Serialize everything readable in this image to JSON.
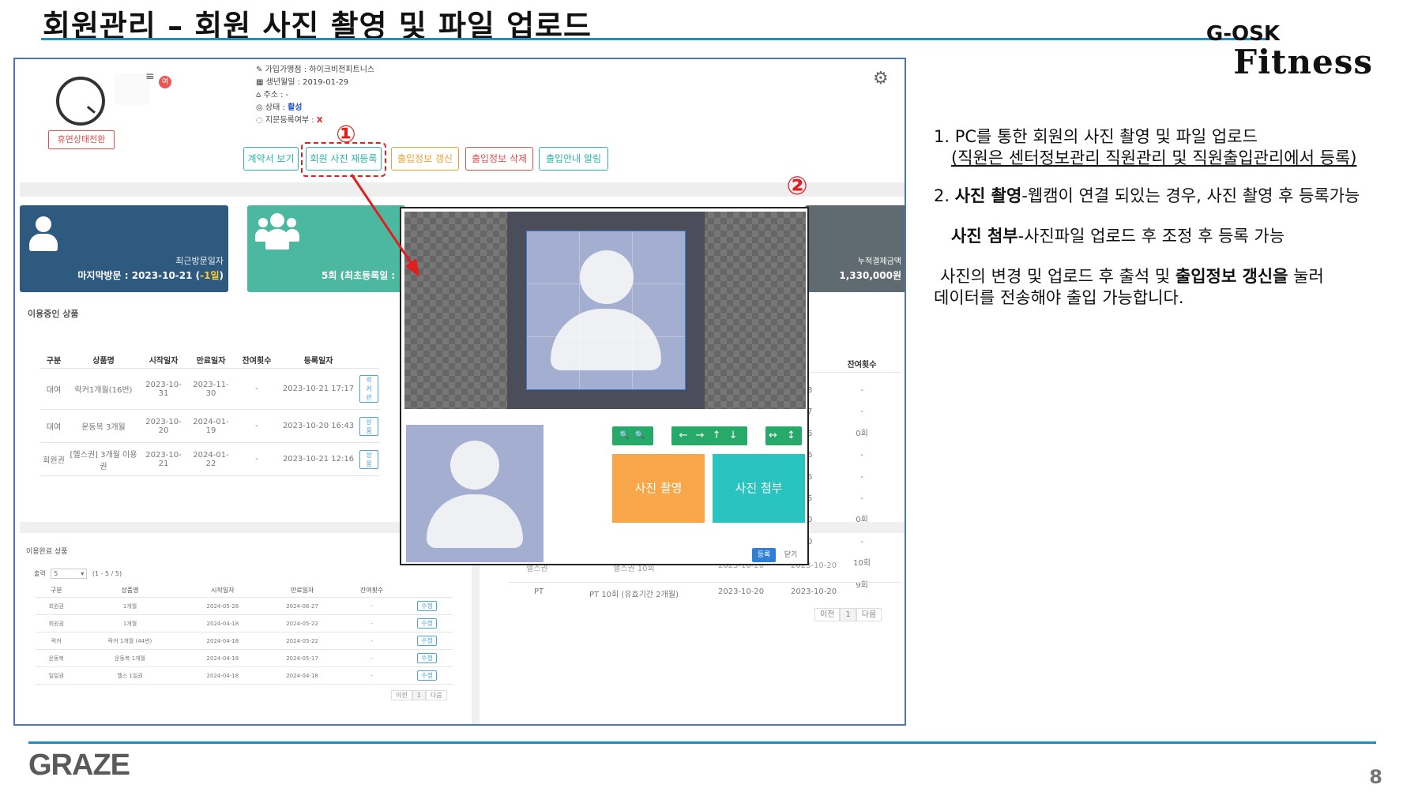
{
  "slide": {
    "title": "회원관리 – 회원 사진 촬영 및 파일 업로드",
    "brand_line1": "G-OSK",
    "brand_line2": "Fitness",
    "footer_logo": "GRAZE",
    "page_number": "8"
  },
  "notes": {
    "item1_line1": "1. PC를 통한 회원의 사진 촬영 및 파일 업로드",
    "item1_line2": "(직원은 센터정보관리 직원관리 및 직원출입관리에서 등록)",
    "item2_prefix": "2. ",
    "item2_bold": "사진 촬영",
    "item2_text": "-웹캠이 연결 되있는 경우, 사진 촬영 후 등록가능",
    "item3_bold": "사진 첨부",
    "item3_text": "-사진파일 업로드 후 조정 후 등록 가능",
    "item4_part1": "사진의 변경 및 업로드 후 출석 및 ",
    "item4_bold": "출입정보 갱신을",
    "item4_part2": " 눌러",
    "item4_line2": "데이터를 전송해야 출입 가능합니다."
  },
  "member": {
    "status_button": "휴면상태전환",
    "name_glyph": "≡",
    "badge": "여",
    "info_branch": "가입가맹점 : 하이크비전피트니스",
    "info_birth": "생년월일 : 2019-01-29",
    "info_address": "주소 : -",
    "info_status_label": "상태 : ",
    "info_status_value": "활성",
    "info_finger_label": "지문등록여부 : ",
    "info_finger_value": "X"
  },
  "actions": {
    "contract": "계약서 보기",
    "photo": "회원 사진 재등록",
    "entry_update": "출입정보 갱신",
    "entry_delete": "출입정보 삭제",
    "entry_notice": "출입안내 알림"
  },
  "markers": {
    "one": "①",
    "two": "②"
  },
  "stats": {
    "last_visit_label": "최근방문일자",
    "last_visit_value": "마지막방문 : 2023-10-21 (",
    "last_visit_delta": "-1일",
    "last_visit_close": ")",
    "count_value": "5회 (최초등록일 :",
    "payment_label": "누적결제금액",
    "payment_value": "1,330,000원"
  },
  "products": {
    "section_title": "이용중인 상품",
    "headers": [
      "구분",
      "상품명",
      "시작일자",
      "만료일자",
      "잔여횟수",
      "등록일자"
    ],
    "rows": [
      [
        "대여",
        "락커1개월(16번)",
        "2023-10-31",
        "2023-11-30",
        "-",
        "2023-10-21 17:17",
        "락커관"
      ],
      [
        "대여",
        "운동복 3개월",
        "2023-10-20",
        "2024-01-19",
        "-",
        "2023-10-20 16:43",
        "상품"
      ],
      [
        "회원권",
        "[헬스권] 3개월 이용권",
        "2023-10-21",
        "2024-01-22",
        "-",
        "2023-10-21 12:16",
        "상품"
      ]
    ]
  },
  "right_table": {
    "header": "잔여횟수",
    "remaining": [
      "-",
      "-",
      "0회",
      "-",
      "-",
      "-",
      "0회",
      "-",
      "10회",
      "9회"
    ],
    "cut_left": [
      "8",
      "7",
      "6",
      "6",
      "6",
      "5",
      "0",
      "0"
    ],
    "row9": [
      "헬스권",
      "헬스권 10회",
      "2023-10-20",
      "2023-10-20"
    ],
    "row10": [
      "PT",
      "PT 10회 (유효기간 2개월)",
      "2023-10-20",
      "2023-10-20"
    ],
    "pager": [
      "이전",
      "1",
      "다음"
    ]
  },
  "expired": {
    "section_title": "이용완료 상품",
    "page_size_label": "출력",
    "page_size": "5",
    "range": "(1 - 5 / 5)",
    "headers": [
      "구분",
      "상품명",
      "시작일자",
      "만료일자",
      "잔여횟수",
      ""
    ],
    "rows": [
      [
        "회원권",
        "1개월",
        "2024-05-28",
        "2024-06-27",
        "-",
        "수정"
      ],
      [
        "회원권",
        "1개월",
        "2024-04-18",
        "2024-05-22",
        "-",
        "수정"
      ],
      [
        "락커",
        "락커 1개월 (44번)",
        "2024-04-18",
        "2024-05-22",
        "-",
        "수정"
      ],
      [
        "운동복",
        "운동복 1개월",
        "2024-04-18",
        "2024-05-17",
        "-",
        "수정"
      ],
      [
        "일일권",
        "헬스 1일권",
        "2024-04-18",
        "2024-04-18",
        "-",
        "수정"
      ]
    ],
    "pager": [
      "이전",
      "1",
      "다음"
    ]
  },
  "modal": {
    "zoom_tools": "🔍 🔍",
    "move_tools": "← → ↑ ↓",
    "flip_tools": "↔ ↕",
    "capture_button": "사진 촬영",
    "attach_button": "사진 첨부",
    "save_button": "등록",
    "close_button": "닫기"
  },
  "colors": {
    "accent_blue": "#1b8fc9",
    "stat_navy": "#2f5a7f",
    "stat_teal": "#4db8a0",
    "capture_orange": "#f7a649",
    "attach_teal": "#29c4c0",
    "marker_red": "#e02020"
  }
}
